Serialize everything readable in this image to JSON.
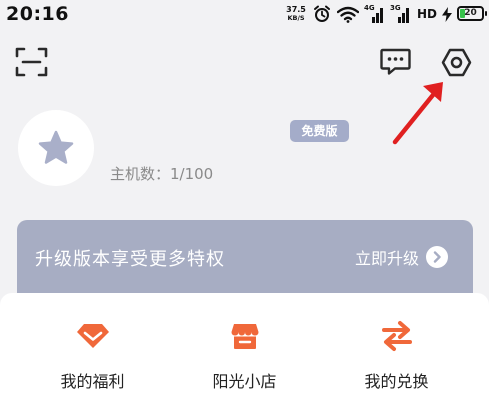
{
  "status_bar": {
    "time": "20:16",
    "net_speed_value": "37.5",
    "net_speed_unit": "KB/S",
    "signal1_tag": "4G",
    "signal2_tag": "3G",
    "hd_tag": "HD",
    "battery_level": "20"
  },
  "toolbar": {
    "scan_icon": "scan-icon",
    "message_icon": "message-icon",
    "settings_icon": "settings-icon"
  },
  "profile": {
    "avatar_icon": "star-icon",
    "plan_badge": "免费版",
    "host_count": "主机数：1/100"
  },
  "banner": {
    "text": "升级版本享受更多特权",
    "button_label": "立即升级"
  },
  "shortcuts": [
    {
      "label": "我的福利",
      "icon": "gift-diamond-icon"
    },
    {
      "label": "阳光小店",
      "icon": "shop-icon"
    },
    {
      "label": "我的兑换",
      "icon": "exchange-icon"
    }
  ],
  "colors": {
    "accent_orange": "#f0683a",
    "banner_bg": "#a7adc3",
    "badge_bg": "#a4acc9",
    "avatar_star": "#a9afc9",
    "annotation_red": "#e02020"
  }
}
